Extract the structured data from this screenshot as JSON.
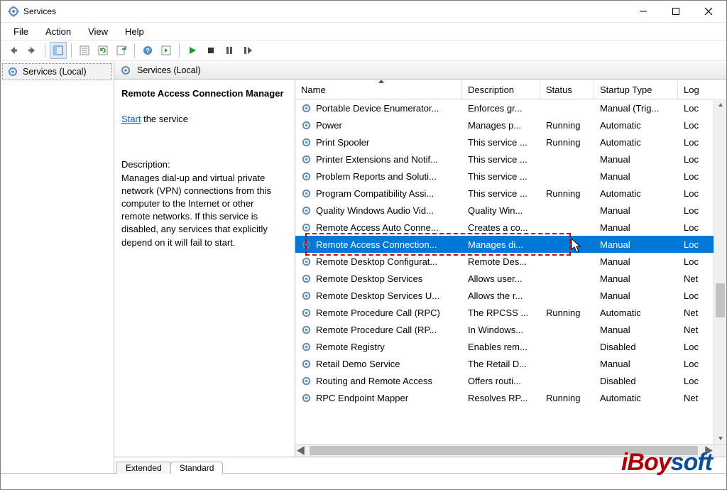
{
  "window": {
    "title": "Services"
  },
  "menu": {
    "file": "File",
    "action": "Action",
    "view": "View",
    "help": "Help"
  },
  "tree": {
    "root": "Services (Local)"
  },
  "header": {
    "title": "Services (Local)"
  },
  "detail": {
    "name": "Remote Access Connection Manager",
    "start_link": "Start",
    "start_rest": " the service",
    "desc_label": "Description:",
    "description": "Manages dial-up and virtual private network (VPN) connections from this computer to the Internet or other remote networks. If this service is disabled, any services that explicitly depend on it will fail to start."
  },
  "columns": {
    "name": "Name",
    "desc": "Description",
    "status": "Status",
    "startup": "Startup Type",
    "logon": "Log"
  },
  "col_widths": {
    "name": 235,
    "desc": 110,
    "status": 76,
    "startup": 118,
    "logon": 40
  },
  "services": [
    {
      "name": "Portable Device Enumerator...",
      "desc": "Enforces gr...",
      "status": "",
      "startup": "Manual (Trig...",
      "logon": "Loc"
    },
    {
      "name": "Power",
      "desc": "Manages p...",
      "status": "Running",
      "startup": "Automatic",
      "logon": "Loc"
    },
    {
      "name": "Print Spooler",
      "desc": "This service ...",
      "status": "Running",
      "startup": "Automatic",
      "logon": "Loc"
    },
    {
      "name": "Printer Extensions and Notif...",
      "desc": "This service ...",
      "status": "",
      "startup": "Manual",
      "logon": "Loc"
    },
    {
      "name": "Problem Reports and Soluti...",
      "desc": "This service ...",
      "status": "",
      "startup": "Manual",
      "logon": "Loc"
    },
    {
      "name": "Program Compatibility Assi...",
      "desc": "This service ...",
      "status": "Running",
      "startup": "Automatic",
      "logon": "Loc"
    },
    {
      "name": "Quality Windows Audio Vid...",
      "desc": "Quality Win...",
      "status": "",
      "startup": "Manual",
      "logon": "Loc"
    },
    {
      "name": "Remote Access Auto Conne...",
      "desc": "Creates a co...",
      "status": "",
      "startup": "Manual",
      "logon": "Loc"
    },
    {
      "name": "Remote Access Connection...",
      "desc": "Manages di...",
      "status": "",
      "startup": "Manual",
      "logon": "Loc",
      "selected": true
    },
    {
      "name": "Remote Desktop Configurat...",
      "desc": "Remote Des...",
      "status": "",
      "startup": "Manual",
      "logon": "Loc"
    },
    {
      "name": "Remote Desktop Services",
      "desc": "Allows user...",
      "status": "",
      "startup": "Manual",
      "logon": "Net"
    },
    {
      "name": "Remote Desktop Services U...",
      "desc": "Allows the r...",
      "status": "",
      "startup": "Manual",
      "logon": "Loc"
    },
    {
      "name": "Remote Procedure Call (RPC)",
      "desc": "The RPCSS ...",
      "status": "Running",
      "startup": "Automatic",
      "logon": "Net"
    },
    {
      "name": "Remote Procedure Call (RP...",
      "desc": "In Windows...",
      "status": "",
      "startup": "Manual",
      "logon": "Net"
    },
    {
      "name": "Remote Registry",
      "desc": "Enables rem...",
      "status": "",
      "startup": "Disabled",
      "logon": "Loc"
    },
    {
      "name": "Retail Demo Service",
      "desc": "The Retail D...",
      "status": "",
      "startup": "Manual",
      "logon": "Loc"
    },
    {
      "name": "Routing and Remote Access",
      "desc": "Offers routi...",
      "status": "",
      "startup": "Disabled",
      "logon": "Loc"
    },
    {
      "name": "RPC Endpoint Mapper",
      "desc": "Resolves RP...",
      "status": "Running",
      "startup": "Automatic",
      "logon": "Net"
    }
  ],
  "tabs": {
    "extended": "Extended",
    "standard": "Standard"
  },
  "watermark": {
    "prefix": "iBoy",
    "suffix": "soft"
  }
}
